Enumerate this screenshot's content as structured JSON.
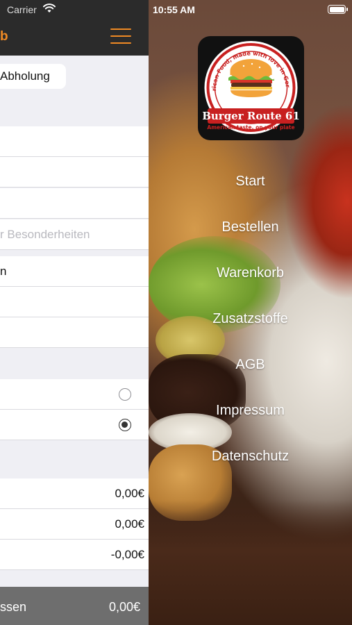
{
  "status_bar": {
    "carrier": "Carrier",
    "time": "10:55 AM"
  },
  "left_panel": {
    "nav_title": "b",
    "segment_label": "Abholung",
    "notes_placeholder": "r Besonderheiten",
    "field_value": "n",
    "amounts": [
      "0,00€",
      "0,00€",
      "-0,00€"
    ],
    "footer": {
      "label": "ssen",
      "amount": "0,00€"
    },
    "radio_selected_index": 1
  },
  "logo": {
    "arc_text": "American Food, made with love in Germany",
    "name": "Burger Route 61",
    "tagline": "American taste, on your plate"
  },
  "menu": {
    "items": [
      "Start",
      "Bestellen",
      "Warenkorb",
      "Zusatzstoffe",
      "AGB",
      "Impressum",
      "Datenschutz"
    ]
  },
  "colors": {
    "accent": "#f08a24",
    "navbar": "#2b2b2b",
    "footer": "#6e6e6e"
  }
}
